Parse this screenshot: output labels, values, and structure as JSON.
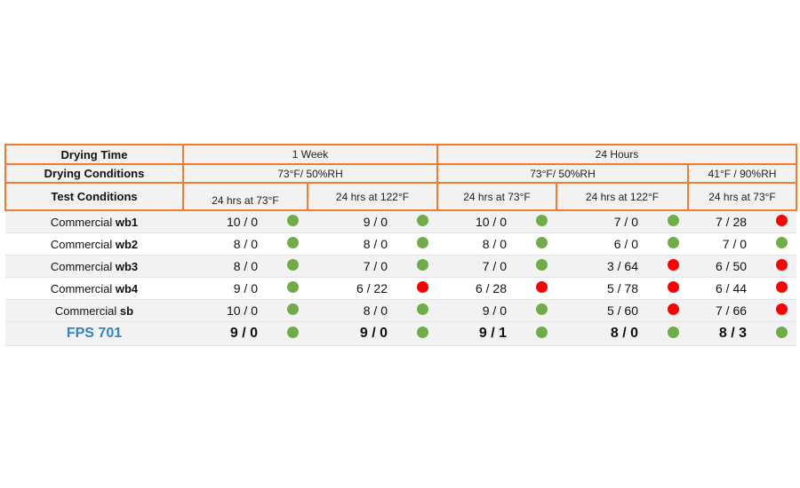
{
  "header": {
    "drying_time_label": "Drying Time",
    "drying_conditions_label": "Drying Conditions",
    "test_conditions_label": "Test Conditions",
    "drying_time_groups": [
      "1 Week",
      "24 Hours"
    ],
    "drying_conditions_groups": [
      "73°F/ 50%RH",
      "73°F/ 50%RH",
      "41°F / 90%RH"
    ],
    "test_conditions": [
      "24 hrs at 73°F",
      "24 hrs  at 122°F",
      "24 hrs  at 73°F",
      "24 hrs  at 122°F",
      "24 hrs  at 73°F"
    ]
  },
  "status_colors": {
    "pass": "#70ad47",
    "fail": "#ff0000",
    "border": "#ed7d31",
    "highlight_text": "#2e86c8"
  },
  "rows": [
    {
      "prefix": "Commercial ",
      "suffix": "wb1",
      "cells": [
        {
          "value": "10 / 0",
          "status": "pass"
        },
        {
          "value": "9 / 0",
          "status": "pass"
        },
        {
          "value": "10 / 0",
          "status": "pass"
        },
        {
          "value": "7 / 0",
          "status": "pass"
        },
        {
          "value": "7 / 28",
          "status": "fail"
        }
      ]
    },
    {
      "prefix": "Commercial ",
      "suffix": "wb2",
      "cells": [
        {
          "value": "8 / 0",
          "status": "pass"
        },
        {
          "value": "8 / 0",
          "status": "pass"
        },
        {
          "value": "8 / 0",
          "status": "pass"
        },
        {
          "value": "6 / 0",
          "status": "pass"
        },
        {
          "value": "7 / 0",
          "status": "pass"
        }
      ]
    },
    {
      "prefix": "Commercial ",
      "suffix": "wb3",
      "cells": [
        {
          "value": "8 / 0",
          "status": "pass"
        },
        {
          "value": "7 / 0",
          "status": "pass"
        },
        {
          "value": "7 / 0",
          "status": "pass"
        },
        {
          "value": "3 / 64",
          "status": "fail"
        },
        {
          "value": "6 / 50",
          "status": "fail"
        }
      ]
    },
    {
      "prefix": "Commercial ",
      "suffix": "wb4",
      "cells": [
        {
          "value": "9 / 0",
          "status": "pass"
        },
        {
          "value": "6 / 22",
          "status": "fail"
        },
        {
          "value": "6 / 28",
          "status": "fail"
        },
        {
          "value": "5 / 78",
          "status": "fail"
        },
        {
          "value": "6 / 44",
          "status": "fail"
        }
      ]
    },
    {
      "prefix": "Commercial ",
      "suffix": "sb",
      "cells": [
        {
          "value": "10 / 0",
          "status": "pass"
        },
        {
          "value": "8 / 0",
          "status": "pass"
        },
        {
          "value": "9 / 0",
          "status": "pass"
        },
        {
          "value": "5 / 60",
          "status": "fail"
        },
        {
          "value": "7 / 66",
          "status": "fail"
        }
      ]
    },
    {
      "prefix": "",
      "suffix": "FPS 701",
      "cells": [
        {
          "value": "9 / 0",
          "status": "pass"
        },
        {
          "value": "9 / 0",
          "status": "pass"
        },
        {
          "value": "9 / 1",
          "status": "pass"
        },
        {
          "value": "8 / 0",
          "status": "pass"
        },
        {
          "value": "8 / 3",
          "status": "pass"
        }
      ]
    }
  ]
}
